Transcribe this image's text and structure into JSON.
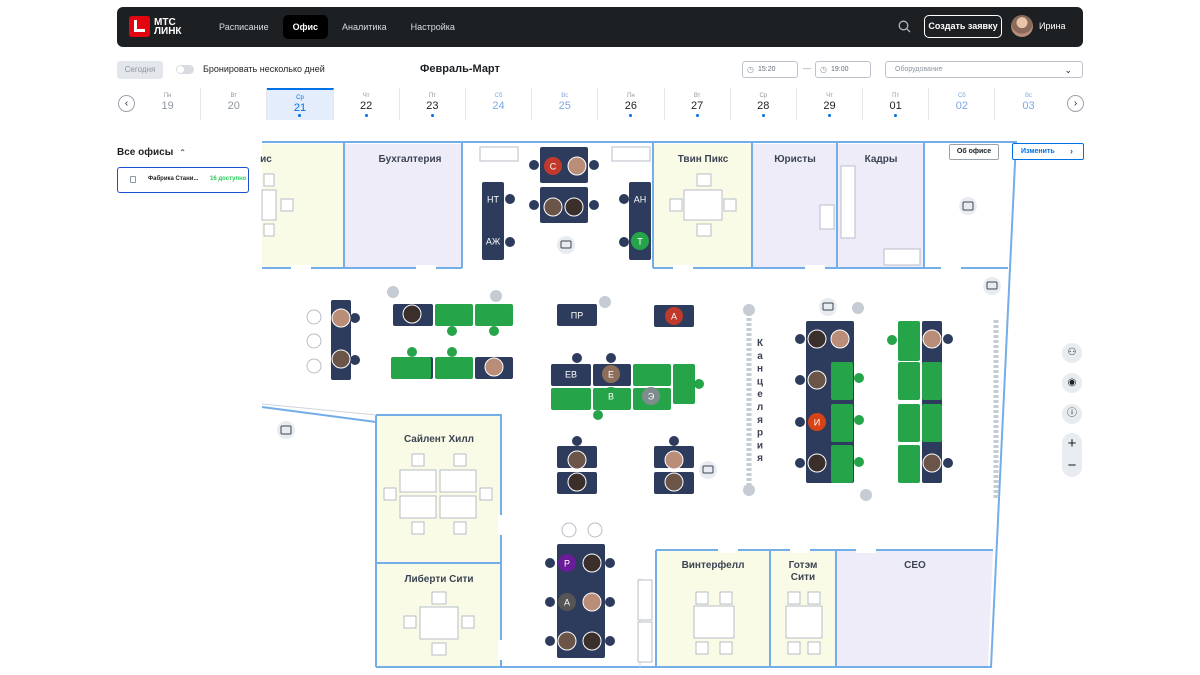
{
  "topbar": {
    "logo_line1": "МТС",
    "logo_line2": "ЛИНК",
    "nav": [
      {
        "label": "Расписание",
        "active": false
      },
      {
        "label": "Офис",
        "active": true
      },
      {
        "label": "Аналитика",
        "active": false
      },
      {
        "label": "Настройка",
        "active": false
      }
    ],
    "create_label": "Создать заявку",
    "user_name": "Ирина"
  },
  "controls": {
    "today_label": "Сегодня",
    "multi_day_label": "Бронировать несколько дней",
    "period_title": "Февраль-Март",
    "time_from": "15:20",
    "time_to": "19:00",
    "time_sep": "—",
    "equipment_placeholder": "Оборудование"
  },
  "days": [
    {
      "w": "Пн",
      "d": "19",
      "state": "past"
    },
    {
      "w": "Вт",
      "d": "20",
      "state": "past"
    },
    {
      "w": "Ср",
      "d": "21",
      "state": "selected"
    },
    {
      "w": "Чт",
      "d": "22",
      "state": "normal"
    },
    {
      "w": "Пт",
      "d": "23",
      "state": "normal"
    },
    {
      "w": "Сб",
      "d": "24",
      "state": "weekend"
    },
    {
      "w": "Вс",
      "d": "25",
      "state": "weekend"
    },
    {
      "w": "Пн",
      "d": "26",
      "state": "normal"
    },
    {
      "w": "Вт",
      "d": "27",
      "state": "normal"
    },
    {
      "w": "Ср",
      "d": "28",
      "state": "normal"
    },
    {
      "w": "Чт",
      "d": "29",
      "state": "normal"
    },
    {
      "w": "Пт",
      "d": "01",
      "state": "normal"
    },
    {
      "w": "Сб",
      "d": "02",
      "state": "weekend"
    },
    {
      "w": "Вс",
      "d": "03",
      "state": "weekend"
    }
  ],
  "sidebar": {
    "title": "Все офисы",
    "office_name": "Фабрика Стани...",
    "office_count": "16 доступно"
  },
  "map": {
    "about_label": "Об офисе",
    "change_label": "Изменить",
    "rooms": {
      "left_partial": "ис",
      "accounting": "Бухгалтерия",
      "twin_peaks": "Твин Пикс",
      "lawyers": "Юристы",
      "hr": "Кадры",
      "silent_hill": "Сайлент Хилл",
      "liberty_city": "Либерти Сити",
      "winterfell": "Винтерфелл",
      "gotham_1": "Готэм",
      "gotham_2": "Сити",
      "ceo": "CEO"
    },
    "chancellery": [
      "К",
      "а",
      "н",
      "ц",
      "е",
      "л",
      "я",
      "р",
      "и",
      "я"
    ],
    "initials": {
      "s": "С",
      "nt": "НТ",
      "azh": "АЖ",
      "an": "АН",
      "t": "Т",
      "pr": "ПР",
      "a1": "А",
      "ev": "ЕВ",
      "e": "Е",
      "v": "В",
      "e2": "Э",
      "i": "И",
      "r": "Р",
      "a2": "А"
    }
  },
  "colors": {
    "accent": "#0070e5",
    "green": "#26a44a",
    "desk_dark": "#2d3b5c",
    "room_yellow": "#fafbe6",
    "room_lilac": "#efecfa",
    "wall": "#74aee8"
  }
}
